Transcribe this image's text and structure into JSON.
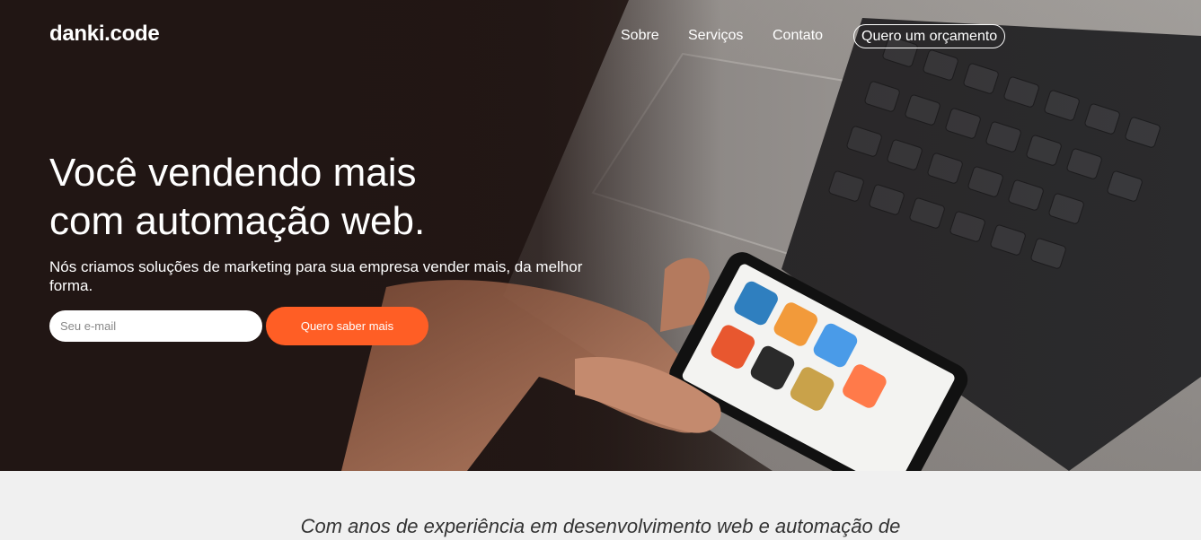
{
  "brand": {
    "logo": "danki.code"
  },
  "nav": {
    "items": [
      "Sobre",
      "Serviços",
      "Contato"
    ],
    "cta": "Quero um orçamento"
  },
  "hero": {
    "headline_line1": "Você vendendo mais",
    "headline_line2": "com automação web.",
    "subline": "Nós criamos soluções de marketing para sua empresa vender mais, da melhor forma.",
    "email_placeholder": "Seu e-mail",
    "button_label": "Quero saber mais",
    "image": "laptop-and-smartphone-photo"
  },
  "section": {
    "tagline": "Com anos de experiência em desenvolvimento web e automação de"
  },
  "colors": {
    "accent": "#ff5e25",
    "hero_dark": "#1f1513",
    "section_bg": "#f0f0f0"
  }
}
